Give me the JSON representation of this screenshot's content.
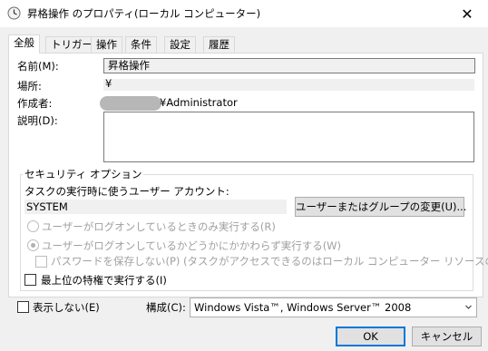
{
  "window": {
    "title": "昇格操作 のプロパティ(ローカル コンピューター)",
    "close_glyph": "✕"
  },
  "tabs": [
    {
      "label": "全般",
      "active": true
    },
    {
      "label": "トリガー"
    },
    {
      "label": "操作"
    },
    {
      "label": "条件"
    },
    {
      "label": "設定"
    },
    {
      "label": "履歴"
    }
  ],
  "general": {
    "name_label": "名前(M):",
    "name_value": "昇格操作",
    "location_label": "場所:",
    "location_value": "¥",
    "author_label": "作成者:",
    "author_value": "¥Administrator",
    "description_label": "説明(D):",
    "description_value": ""
  },
  "security": {
    "group_title": "セキュリティ オプション",
    "account_prompt": "タスクの実行時に使うユーザー アカウント:",
    "account_value": "SYSTEM",
    "change_button": "ユーザーまたはグループの変更(U)...",
    "radio_logged_on_only": "ユーザーがログオンしているときのみ実行する(R)",
    "radio_logged_on_any": "ユーザーがログオンしているかどうかにかかわらず実行する(W)",
    "do_not_store_password": "パスワードを保存しない(P) (タスクがアクセスできるのはローカル コンピューター リソースのみ)",
    "highest_privileges": "最上位の特権で実行する(I)"
  },
  "footer": {
    "hidden_label": "表示しない(E)",
    "configure_label": "構成(C):",
    "configure_value": "Windows Vista™, Windows Server™ 2008",
    "ok_button": "OK",
    "cancel_button": "キャンセル"
  }
}
